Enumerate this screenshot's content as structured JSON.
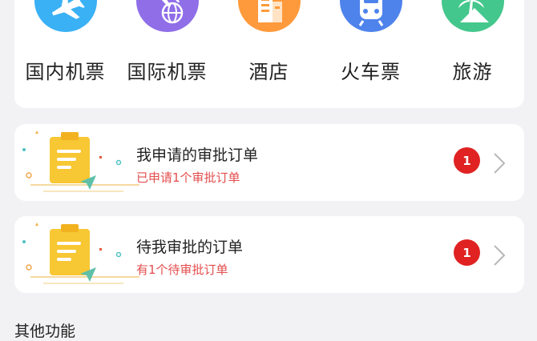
{
  "services": [
    {
      "label": "国内机票",
      "icon": "airplane-icon",
      "color": "#3ab0f5"
    },
    {
      "label": "国际机票",
      "icon": "globe-plane-icon",
      "color": "#8f6ee8"
    },
    {
      "label": "酒店",
      "icon": "hotel-building-icon",
      "color": "#ff9a3c"
    },
    {
      "label": "火车票",
      "icon": "train-icon",
      "color": "#4f83ec"
    },
    {
      "label": "旅游",
      "icon": "palm-tree-icon",
      "color": "#44c78c"
    }
  ],
  "approval_cards": [
    {
      "title": "我申请的审批订单",
      "subtitle": "已申请1个审批订单",
      "badge": "1"
    },
    {
      "title": "待我审批的订单",
      "subtitle": "有1个待审批订单",
      "badge": "1"
    }
  ],
  "other_section": {
    "title": "其他功能"
  }
}
